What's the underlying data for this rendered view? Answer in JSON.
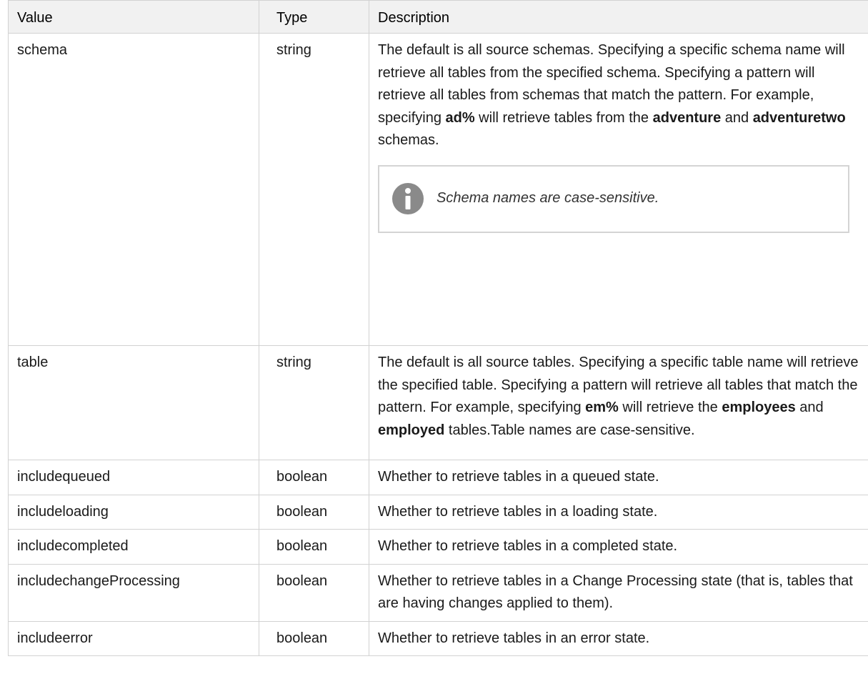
{
  "headers": {
    "value": "Value",
    "type": "Type",
    "description": "Description"
  },
  "rows": [
    {
      "value": "schema",
      "type": "string",
      "desc_part1": "The default is all source schemas. Specifying a specific schema name will retrieve all tables from the specified schema. Specifying a pattern will retrieve all tables from schemas that match the pattern. For example, specifying ",
      "desc_bold1": "ad%",
      "desc_part2": " will retrieve tables from the ",
      "desc_bold2": "adventure",
      "desc_part3": " and ",
      "desc_bold3": "adventuretwo",
      "desc_part4": " schemas.",
      "note": "Schema names are case-sensitive."
    },
    {
      "value": "table",
      "type": "string",
      "desc_part1": "The default is all source tables. Specifying a specific table name will retrieve the specified table. Specifying a pattern will retrieve all tables that match the pattern. For example, specifying ",
      "desc_bold1": "em%",
      "desc_part2": " will retrieve the ",
      "desc_bold2": "employees",
      "desc_part3": " and ",
      "desc_bold3": "employed",
      "desc_part4": " tables.Table names are case-sensitive."
    },
    {
      "value": "includequeued",
      "type": "boolean",
      "description": "Whether to retrieve tables in a queued state."
    },
    {
      "value": "includeloading",
      "type": "boolean",
      "description": "Whether to retrieve tables in a loading state."
    },
    {
      "value": "includecompleted",
      "type": "boolean",
      "description": "Whether to retrieve tables in a completed state."
    },
    {
      "value": "includechangeProcessing",
      "type": "boolean",
      "description": "Whether to retrieve tables in a Change Processing state (that is, tables that are having changes applied to them)."
    },
    {
      "value": "includeerror",
      "type": "boolean",
      "description": "Whether to retrieve tables in an error state."
    }
  ],
  "colors": {
    "header_bg": "#f1f1f1",
    "border": "#d2d2d2",
    "info_icon": "#8a8a8a"
  },
  "icons": {
    "note_icon": "info-icon"
  }
}
